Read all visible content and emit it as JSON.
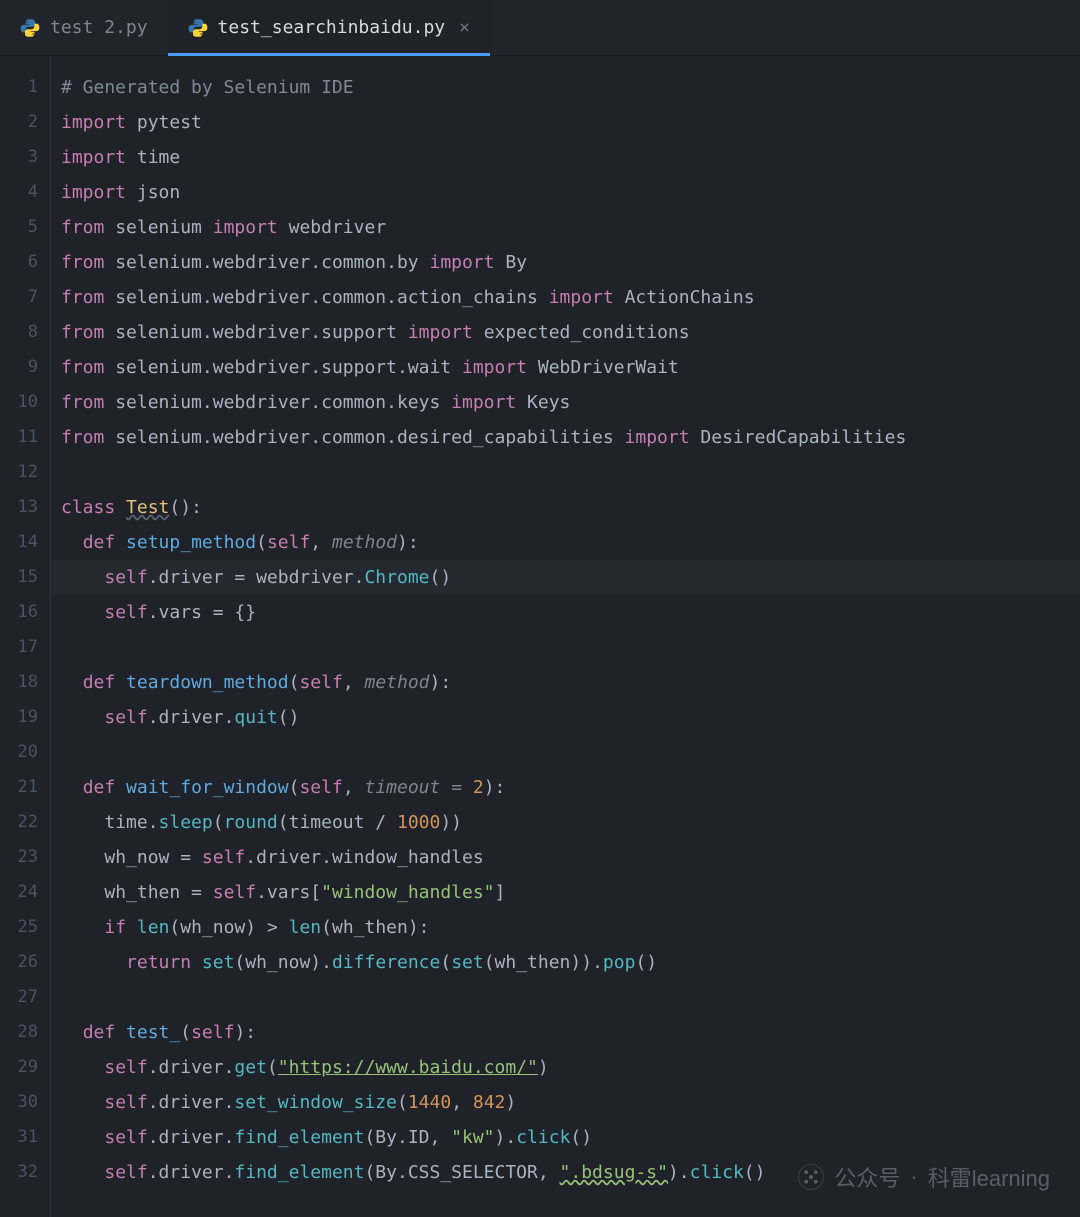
{
  "tabs": [
    {
      "label": "test 2.py",
      "active": false
    },
    {
      "label": "test_searchinbaidu.py",
      "active": true
    }
  ],
  "active_line": 15,
  "code": {
    "l1": {
      "comment": "# Generated by Selenium IDE"
    },
    "l2": {
      "kw": "import",
      "mod": "pytest"
    },
    "l3": {
      "kw": "import",
      "mod": "time"
    },
    "l4": {
      "kw": "import",
      "mod": "json"
    },
    "l5": {
      "kw1": "from",
      "mod": "selenium",
      "kw2": "import",
      "name": "webdriver"
    },
    "l6": {
      "kw1": "from",
      "mod": "selenium.webdriver.common.by",
      "kw2": "import",
      "name": "By"
    },
    "l7": {
      "kw1": "from",
      "mod": "selenium.webdriver.common.action_chains",
      "kw2": "import",
      "name": "ActionChains"
    },
    "l8": {
      "kw1": "from",
      "mod": "selenium.webdriver.support",
      "kw2": "import",
      "name": "expected_conditions"
    },
    "l9": {
      "kw1": "from",
      "mod": "selenium.webdriver.support.wait",
      "kw2": "import",
      "name": "WebDriverWait"
    },
    "l10": {
      "kw1": "from",
      "mod": "selenium.webdriver.common.keys",
      "kw2": "import",
      "name": "Keys"
    },
    "l11": {
      "kw1": "from",
      "mod": "selenium.webdriver.common.desired_capabilities",
      "kw2": "import",
      "name": "DesiredCapabilities"
    },
    "l13": {
      "kw": "class",
      "name": "Test",
      "paren": "():"
    },
    "l14": {
      "kw": "def",
      "name": "setup_method",
      "p_self": "self",
      "p2": "method"
    },
    "l15": {
      "self": "self",
      "rest1": ".driver = webdriver.",
      "call": "Chrome",
      "tail": "()"
    },
    "l16": {
      "self": "self",
      "rest": ".vars = {}"
    },
    "l18": {
      "kw": "def",
      "name": "teardown_method",
      "p_self": "self",
      "p2": "method"
    },
    "l19": {
      "self": "self",
      "rest1": ".driver.",
      "call": "quit",
      "tail": "()"
    },
    "l21": {
      "kw": "def",
      "name": "wait_for_window",
      "p_self": "self",
      "p2": "timeout",
      "eq": " = ",
      "dflt": "2"
    },
    "l22": {
      "pre": "time.",
      "call1": "sleep",
      "p1": "(",
      "call2": "round",
      "p2": "(timeout / ",
      "num": "1000",
      "tail": "))"
    },
    "l23": {
      "lhs": "wh_now = ",
      "self": "self",
      "rest": ".driver.window_handles"
    },
    "l24": {
      "lhs": "wh_then = ",
      "self": "self",
      "rest1": ".vars[",
      "str": "\"window_handles\"",
      "tail": "]"
    },
    "l25": {
      "kw1": "if",
      "c1": "len",
      "a1": "(wh_now) > ",
      "c2": "len",
      "a2": "(wh_then):"
    },
    "l26": {
      "kw": "return",
      "c1": "set",
      "a1": "(wh_now).",
      "c2": "difference",
      "a2": "(",
      "c3": "set",
      "a3": "(wh_then)).",
      "c4": "pop",
      "tail": "()"
    },
    "l28": {
      "kw": "def",
      "name": "test_",
      "p_self": "self"
    },
    "l29": {
      "self": "self",
      "rest1": ".driver.",
      "call": "get",
      "p1": "(",
      "str": "\"https://www.baidu.com/\"",
      "tail": ")"
    },
    "l30": {
      "self": "self",
      "rest1": ".driver.",
      "call": "set_window_size",
      "p1": "(",
      "n1": "1440",
      "sep": ", ",
      "n2": "842",
      "tail": ")"
    },
    "l31": {
      "self": "self",
      "rest1": ".driver.",
      "call": "find_element",
      "p1": "(By.ID, ",
      "str": "\"kw\"",
      "rest2": ").",
      "call2": "click",
      "tail": "()"
    },
    "l32": {
      "self": "self",
      "rest1": ".driver.",
      "call": "find_element",
      "p1": "(By.CSS_SELECTOR, ",
      "str": "\".bdsug-s\"",
      "rest2": ").",
      "call2": "click",
      "tail": "()"
    }
  },
  "watermark": {
    "label": "公众号",
    "label_b": "科雷learning"
  }
}
